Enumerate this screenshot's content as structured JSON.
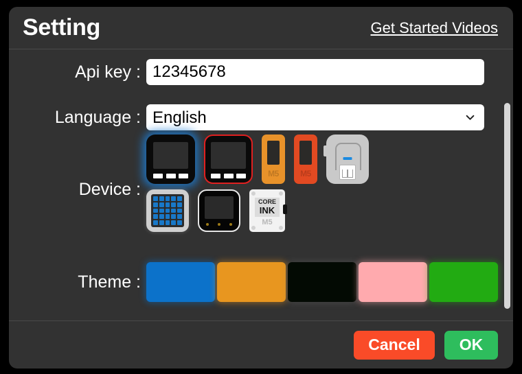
{
  "dialog": {
    "title": "Setting",
    "header_link": "Get Started Videos"
  },
  "form": {
    "api_key": {
      "label": "Api key :",
      "value": "12345678",
      "placeholder": ""
    },
    "language": {
      "label": "Language :",
      "value": "English",
      "options": [
        "English"
      ]
    },
    "device": {
      "label": "Device :",
      "selected_index": 0,
      "items": [
        {
          "name": "core-black",
          "type": "core",
          "body_color": "#0a0a0a",
          "screen_color": "#2e2e2e",
          "state": "selected-blue-glow"
        },
        {
          "name": "core-red-outline",
          "type": "core",
          "body_color": "#0a0a0a",
          "screen_color": "#2e2e2e",
          "state": "red-border"
        },
        {
          "name": "stick-orange",
          "type": "stick",
          "body_color": "#e8922a",
          "label": "M5"
        },
        {
          "name": "stick-red",
          "type": "stick",
          "body_color": "#e24a22",
          "label": "M5"
        },
        {
          "name": "unit-gray",
          "type": "gray",
          "body_color": "#c9c9c9",
          "accent": "#1b8ae0"
        },
        {
          "name": "atom-matrix",
          "type": "matrix",
          "body_color": "#cfcfcf",
          "led_color": "#1878c8",
          "rows": 5,
          "cols": 5
        },
        {
          "name": "core-black-outline",
          "type": "black",
          "body_color": "#050505",
          "border_color": "#e8e8e8"
        },
        {
          "name": "core-ink",
          "type": "ink",
          "text_top": "CORE",
          "text_main": "INK",
          "text_bottom": "M5"
        }
      ]
    },
    "theme": {
      "label": "Theme :",
      "swatches": [
        {
          "name": "theme-blue",
          "color": "#0c72ca"
        },
        {
          "name": "theme-orange",
          "color": "#e8961f"
        },
        {
          "name": "theme-black",
          "color": "#030a03"
        },
        {
          "name": "theme-pink",
          "color": "#ffaaae"
        },
        {
          "name": "theme-green",
          "color": "#22ab12"
        }
      ]
    }
  },
  "footer": {
    "cancel_label": "Cancel",
    "ok_label": "OK",
    "cancel_color": "#fa4b28",
    "ok_color": "#2ebd5d"
  }
}
